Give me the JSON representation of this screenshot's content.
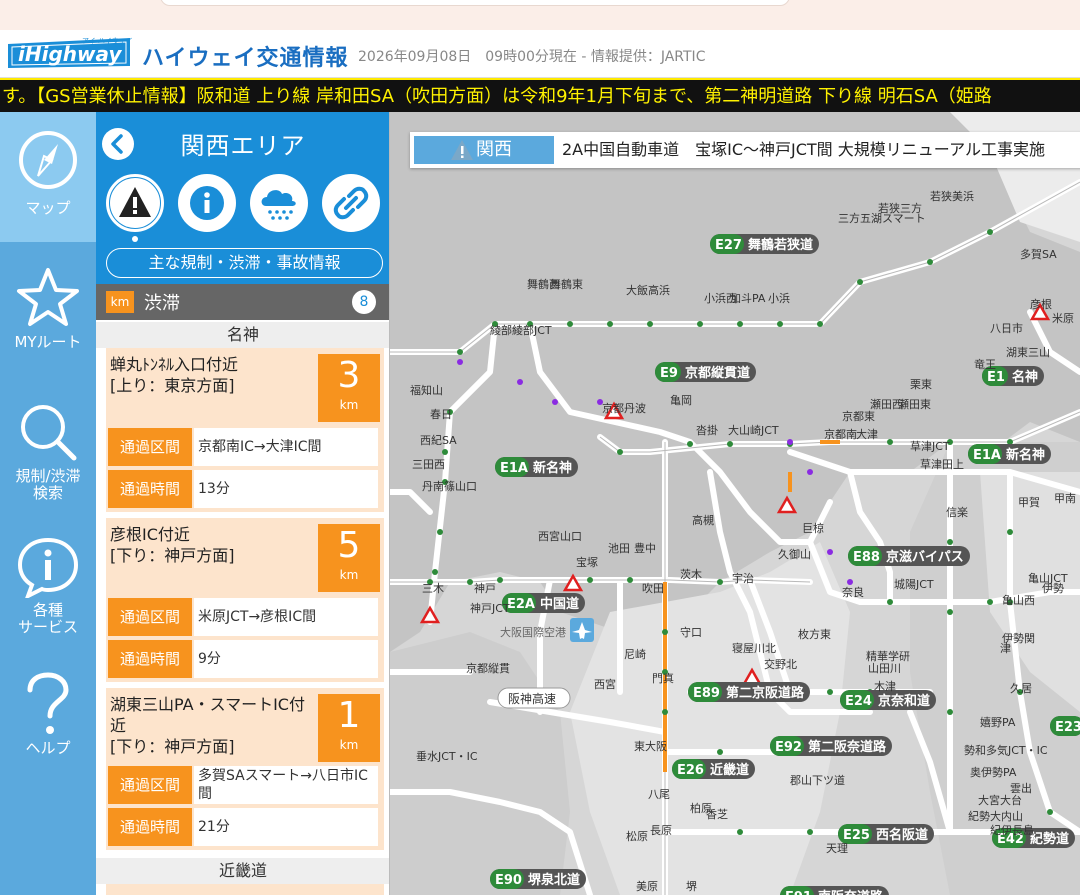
{
  "header": {
    "site_title": "ハイウェイ交通情報",
    "datetime": "2026年09月08日　09時00分現在 - 情報提供：JARTIC",
    "logo_text": "iHighway",
    "logo_sub": "アイ ハイウェイ"
  },
  "ticker": "す。【GS営業休止情報】阪和道 上り線 岸和田SA（吹田方面）は令和9年1月下旬まで、第二神明道路 下り線 明石SA（姫路",
  "nav": {
    "items": [
      {
        "label": "マップ",
        "icon": "compass-icon"
      },
      {
        "label": "MYルート",
        "icon": "star-icon"
      },
      {
        "label": "規制/渋滞\n検索",
        "icon": "search-icon"
      },
      {
        "label": "各種\nサービス",
        "icon": "info-bubble-icon"
      },
      {
        "label": "ヘルプ",
        "icon": "question-icon"
      }
    ]
  },
  "panel": {
    "area_title": "関西エリア",
    "category_link": "主な規制・渋滞・事故情報",
    "jam": {
      "unit": "km",
      "title": "渋滞",
      "count": "8"
    },
    "routes": [
      {
        "name": "名神",
        "items": [
          {
            "loc": "蝉丸ﾄﾝﾈﾙ入口付近\n[上り：東京方面]",
            "km": "3",
            "unit": "km",
            "section_label": "通過区間",
            "section": "京都南IC→大津IC間",
            "time_label": "通過時間",
            "time": "13分"
          },
          {
            "loc": "彦根IC付近\n[下り：神戸方面]",
            "km": "5",
            "unit": "km",
            "section_label": "通過区間",
            "section": "米原JCT→彦根IC間",
            "time_label": "通過時間",
            "time": "9分"
          },
          {
            "loc": "湖東三山PA・スマートIC付近\n[下り：神戸方面]",
            "km": "1",
            "unit": "km",
            "section_label": "通過区間",
            "section": "多賀SAスマート→八日市IC間",
            "time_label": "通過時間",
            "time": "21分"
          }
        ]
      },
      {
        "name": "近畿道"
      }
    ]
  },
  "map": {
    "news_tag": "関西",
    "news_text": "2A中国自動車道　宝塚IC～神戸JCT間 大規模リニューアル工事実施",
    "highway_badges": [
      {
        "code": "E27",
        "name": "舞鶴若狭道"
      },
      {
        "code": "E9",
        "name": "京都縦貫道"
      },
      {
        "code": "E1",
        "name": "名神"
      },
      {
        "code": "E1A",
        "name": "新名神"
      },
      {
        "code": "E1A",
        "name": "新名神"
      },
      {
        "code": "E2A",
        "name": "中国道"
      },
      {
        "code": "E88",
        "name": "京滋バイパス"
      },
      {
        "code": "E89",
        "name": "第二京阪道路"
      },
      {
        "code": "E24",
        "name": "京奈和道"
      },
      {
        "code": "E92",
        "name": "第二阪奈道路"
      },
      {
        "code": "E26",
        "name": "近畿道"
      },
      {
        "code": "E25",
        "name": "西名阪道"
      },
      {
        "code": "E90",
        "name": "堺泉北道"
      },
      {
        "code": "E91",
        "name": "南阪奈道路"
      },
      {
        "code": "E42",
        "name": "紀勢道"
      },
      {
        "code": "E23",
        "name": ""
      }
    ],
    "place_labels": [
      "若狭美浜",
      "若狭三方",
      "三方五湖スマート",
      "小浜",
      "小浜西",
      "加斗PA",
      "大飯高浜",
      "舞鶴西",
      "舞鶴東",
      "綾部",
      "綾部JCT",
      "京都丹波",
      "亀岡",
      "沓掛",
      "大山崎JCT",
      "京都南",
      "京都東",
      "大津",
      "瀬田西",
      "瀬田東",
      "草津田上",
      "草津JCT",
      "信楽",
      "栗東",
      "竜王",
      "八日市",
      "湖東三山",
      "彦根",
      "米原",
      "多賀SA",
      "甲賀",
      "甲南",
      "亀山西",
      "亀山JCT",
      "伊勢関",
      "吹田",
      "茨木",
      "高槻",
      "神戸JCT",
      "西宮山口",
      "三木",
      "神戸",
      "宝塚",
      "池田",
      "豊中",
      "守口",
      "門真",
      "寝屋川北",
      "交野北",
      "枚方東",
      "城陽JCT",
      "宇治",
      "巨椋",
      "久御山",
      "大阪国際空港",
      "阪神高速",
      "西宮",
      "尼崎",
      "東大阪",
      "松原",
      "美原",
      "堺",
      "天理",
      "郡山下ツ道",
      "香芝",
      "柏原",
      "八尾",
      "長原",
      "垂水JCT・IC",
      "三田西",
      "福知山",
      "春日",
      "西紀SA",
      "丹南篠山口",
      "京都縦貫",
      "山田川",
      "木津",
      "精華学研",
      "奈良",
      "勢和多気JCT・IC",
      "奥伊勢PA",
      "大宮大台",
      "紀勢大内山",
      "紀伊長島",
      "伊勢",
      "津",
      "久居",
      "嬉野PA",
      "雲出"
    ]
  },
  "colors": {
    "brand_blue": "#1a8ed8",
    "nav_blue": "#5ba9dd",
    "orange": "#f7931e",
    "ticker_text": "#fff200",
    "highway_green": "#2e8b3a",
    "ic_purple": "#8a2be2",
    "map_bg": "#d7d7d7"
  }
}
